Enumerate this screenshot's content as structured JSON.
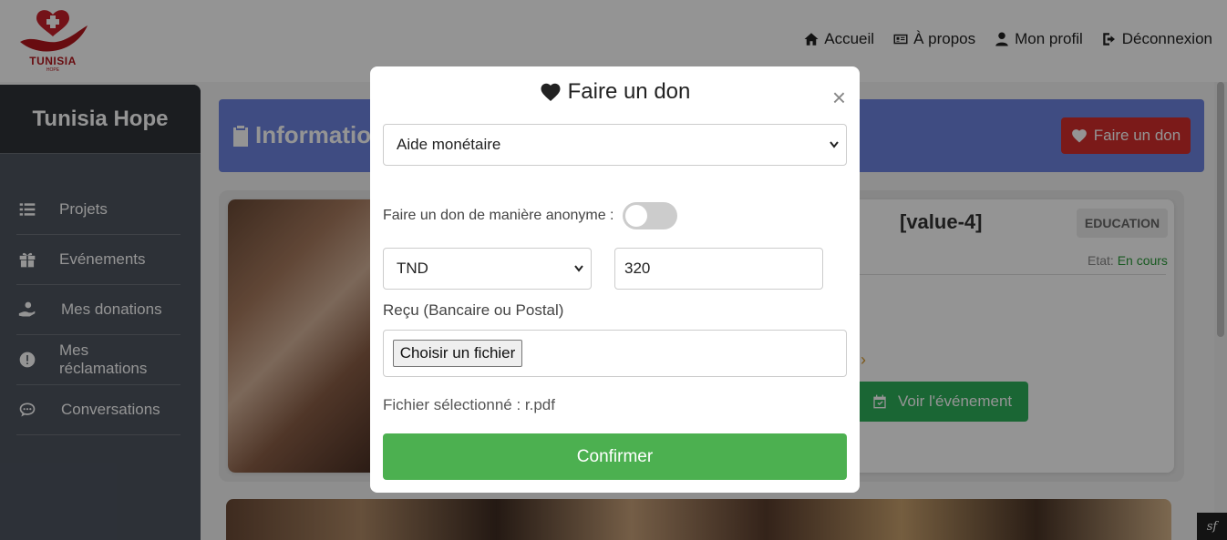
{
  "brand": {
    "logo_text": "TUNISIA",
    "logo_sub": "HOPE"
  },
  "nav": {
    "items": [
      {
        "label": "Accueil",
        "icon": "home-icon"
      },
      {
        "label": "À propos",
        "icon": "id-card-icon"
      },
      {
        "label": "Mon profil",
        "icon": "user-icon"
      },
      {
        "label": "Déconnexion",
        "icon": "logout-icon"
      }
    ]
  },
  "sidebar": {
    "title": "Tunisia Hope",
    "items": [
      {
        "label": "Projets",
        "icon": "list-icon"
      },
      {
        "label": "Evénements",
        "icon": "gift-icon"
      },
      {
        "label": "Mes donations",
        "icon": "donate-icon"
      },
      {
        "label": "Mes réclamations",
        "icon": "alert-icon"
      },
      {
        "label": "Conversations",
        "icon": "chat-icon"
      }
    ]
  },
  "banner": {
    "title": "Informatio",
    "donate_label": "Faire un don"
  },
  "card": {
    "title": "[value-4]",
    "category": "EDUCATION",
    "etat_label": "Etat:",
    "etat_value": "En cours",
    "event_button": "Voir l'événement"
  },
  "modal": {
    "title": "Faire un don",
    "type_select": "Aide monétaire",
    "anonymous_label": "Faire un don de manière anonyme :",
    "anonymous_enabled": false,
    "currency_select": "TND",
    "amount_value": "320",
    "receipt_label": "Reçu (Bancaire ou Postal)",
    "file_button": "Choisir un fichier",
    "selected_file": "Fichier sélectionné : r.pdf",
    "confirm_label": "Confirmer",
    "close_label": "×"
  },
  "colors": {
    "banner": "#6d84e0",
    "donate_button": "#d42e2c",
    "confirm_button": "#4cb050",
    "event_button": "#2eb05b",
    "sidebar": "#4e5560"
  },
  "footer": {
    "symfony_badge": "sf"
  }
}
